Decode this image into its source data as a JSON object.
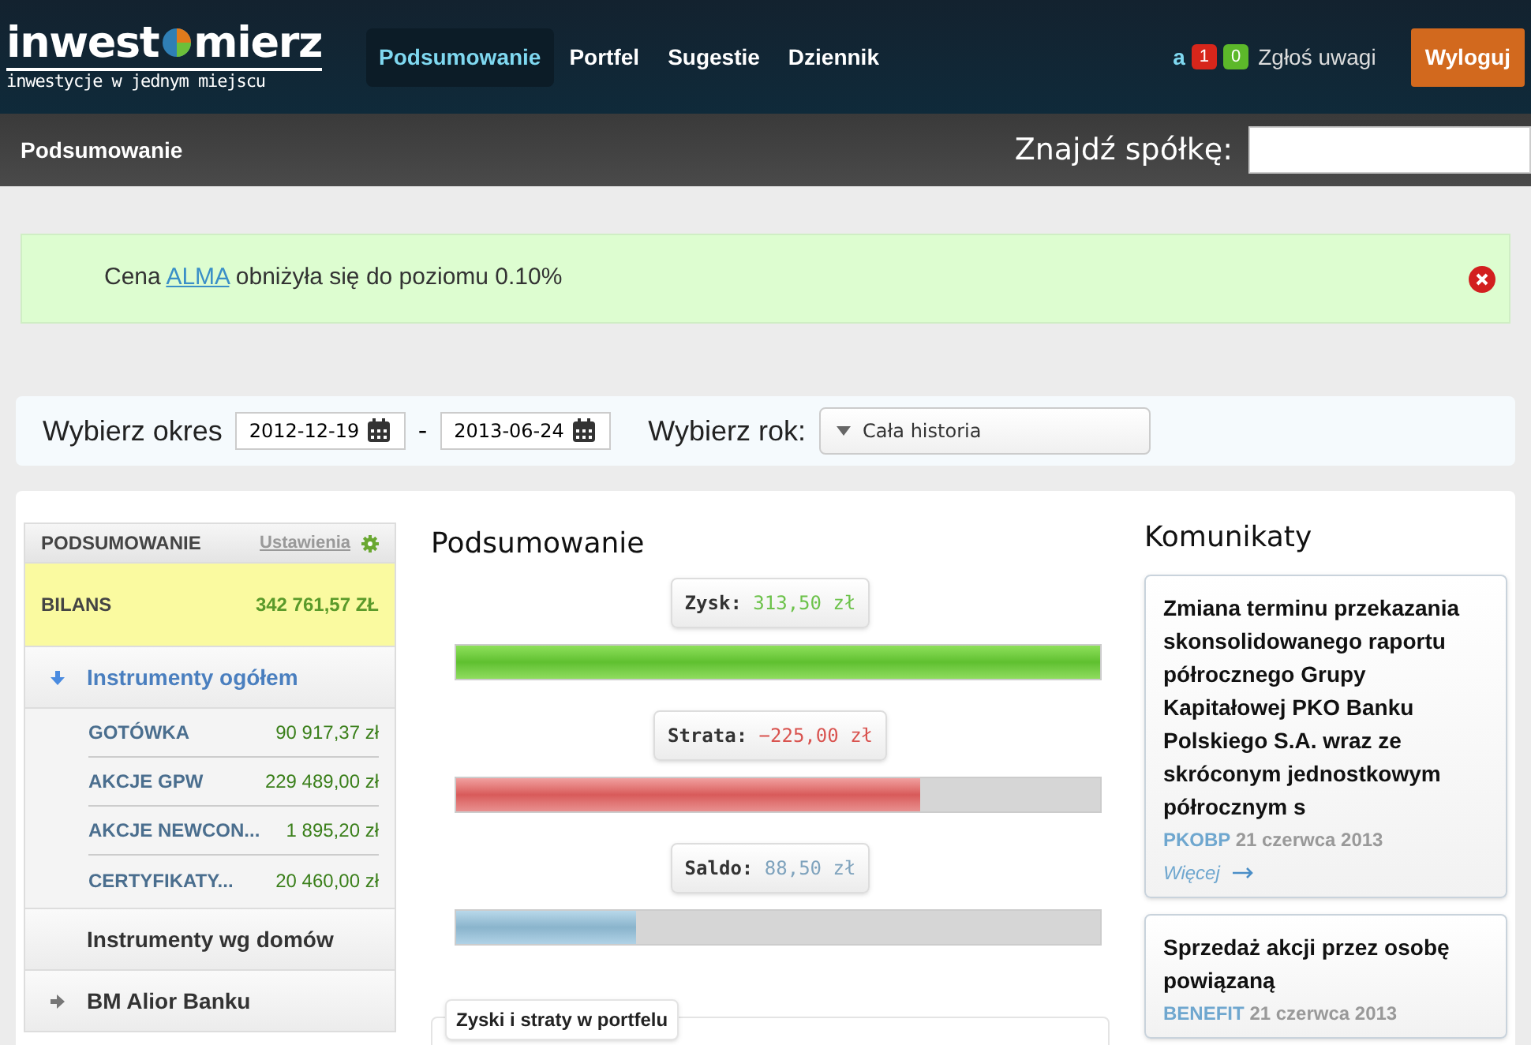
{
  "logo": {
    "text_left": "inwest",
    "text_right": "mierz",
    "tagline": "inwestycje w jednym miejscu"
  },
  "nav": [
    {
      "label": "Podsumowanie",
      "selected": true
    },
    {
      "label": "Portfel",
      "selected": false
    },
    {
      "label": "Sugestie",
      "selected": false
    },
    {
      "label": "Dziennik",
      "selected": false
    }
  ],
  "user": {
    "name": "a",
    "badges": [
      {
        "count": "1",
        "color": "#d7261b"
      },
      {
        "count": "0",
        "color": "#5cb82a"
      }
    ],
    "feedback": "Zgłoś uwagi",
    "logout": "Wyloguj"
  },
  "subbar": {
    "title": "Podsumowanie",
    "search_label": "Znajdź spółkę:"
  },
  "alert": {
    "before": "Cena ",
    "link": "ALMA",
    "after": " obniżyła się do poziomu 0.10%"
  },
  "filter": {
    "period_label": "Wybierz okres",
    "from": "2012-12-19",
    "separator": "-",
    "to": "2013-06-24",
    "year_label": "Wybierz rok:",
    "year_value": "Cała historia"
  },
  "sidebar": {
    "title": "PODSUMOWANIE",
    "settings": "Ustawienia",
    "balance_label": "BILANS",
    "balance_value": "342 761,57 ZŁ",
    "groups": [
      {
        "kind": "toggle",
        "label": "Instrumenty ogółem",
        "expanded": true,
        "items": [
          {
            "name": "GOTÓWKA",
            "value": "90 917,37 zł"
          },
          {
            "name": "AKCJE GPW",
            "value": "229 489,00 zł"
          },
          {
            "name": "AKCJE NEWCON...",
            "value": "1 895,20 zł"
          },
          {
            "name": "CERTYFIKATY...",
            "value": "20 460,00 zł"
          }
        ]
      },
      {
        "kind": "heading",
        "label": "Instrumenty wg domów"
      },
      {
        "kind": "toggle",
        "label": "BM Alior Banku",
        "expanded": false
      }
    ]
  },
  "summary": {
    "title": "Podsumowanie",
    "bars": [
      {
        "kind": "profit",
        "label": "Zysk:",
        "value": "313,50 zł",
        "level": 1.0
      },
      {
        "kind": "loss",
        "label": "Strata:",
        "value": "−225,00 zł",
        "level": 0.72
      },
      {
        "kind": "balance",
        "label": "Saldo:",
        "value": "88,50 zł",
        "level": 0.28
      }
    ],
    "panel_title": "Zyski i straty w portfelu"
  },
  "news": {
    "title": "Komunikaty",
    "items": [
      {
        "headline": "Zmiana terminu przekazania skonsolidowanego raportu półrocznego Grupy Kapitałowej PKO Banku Polskiego S.A. wraz ze skróconym jednostkowym półrocznym s",
        "ticker": "PKOBP",
        "date": "21 czerwca 2013",
        "more": "Więcej"
      },
      {
        "headline": "Sprzedaż akcji przez osobę powiązaną",
        "ticker": "BENEFIT",
        "date": "21 czerwca 2013"
      }
    ]
  }
}
